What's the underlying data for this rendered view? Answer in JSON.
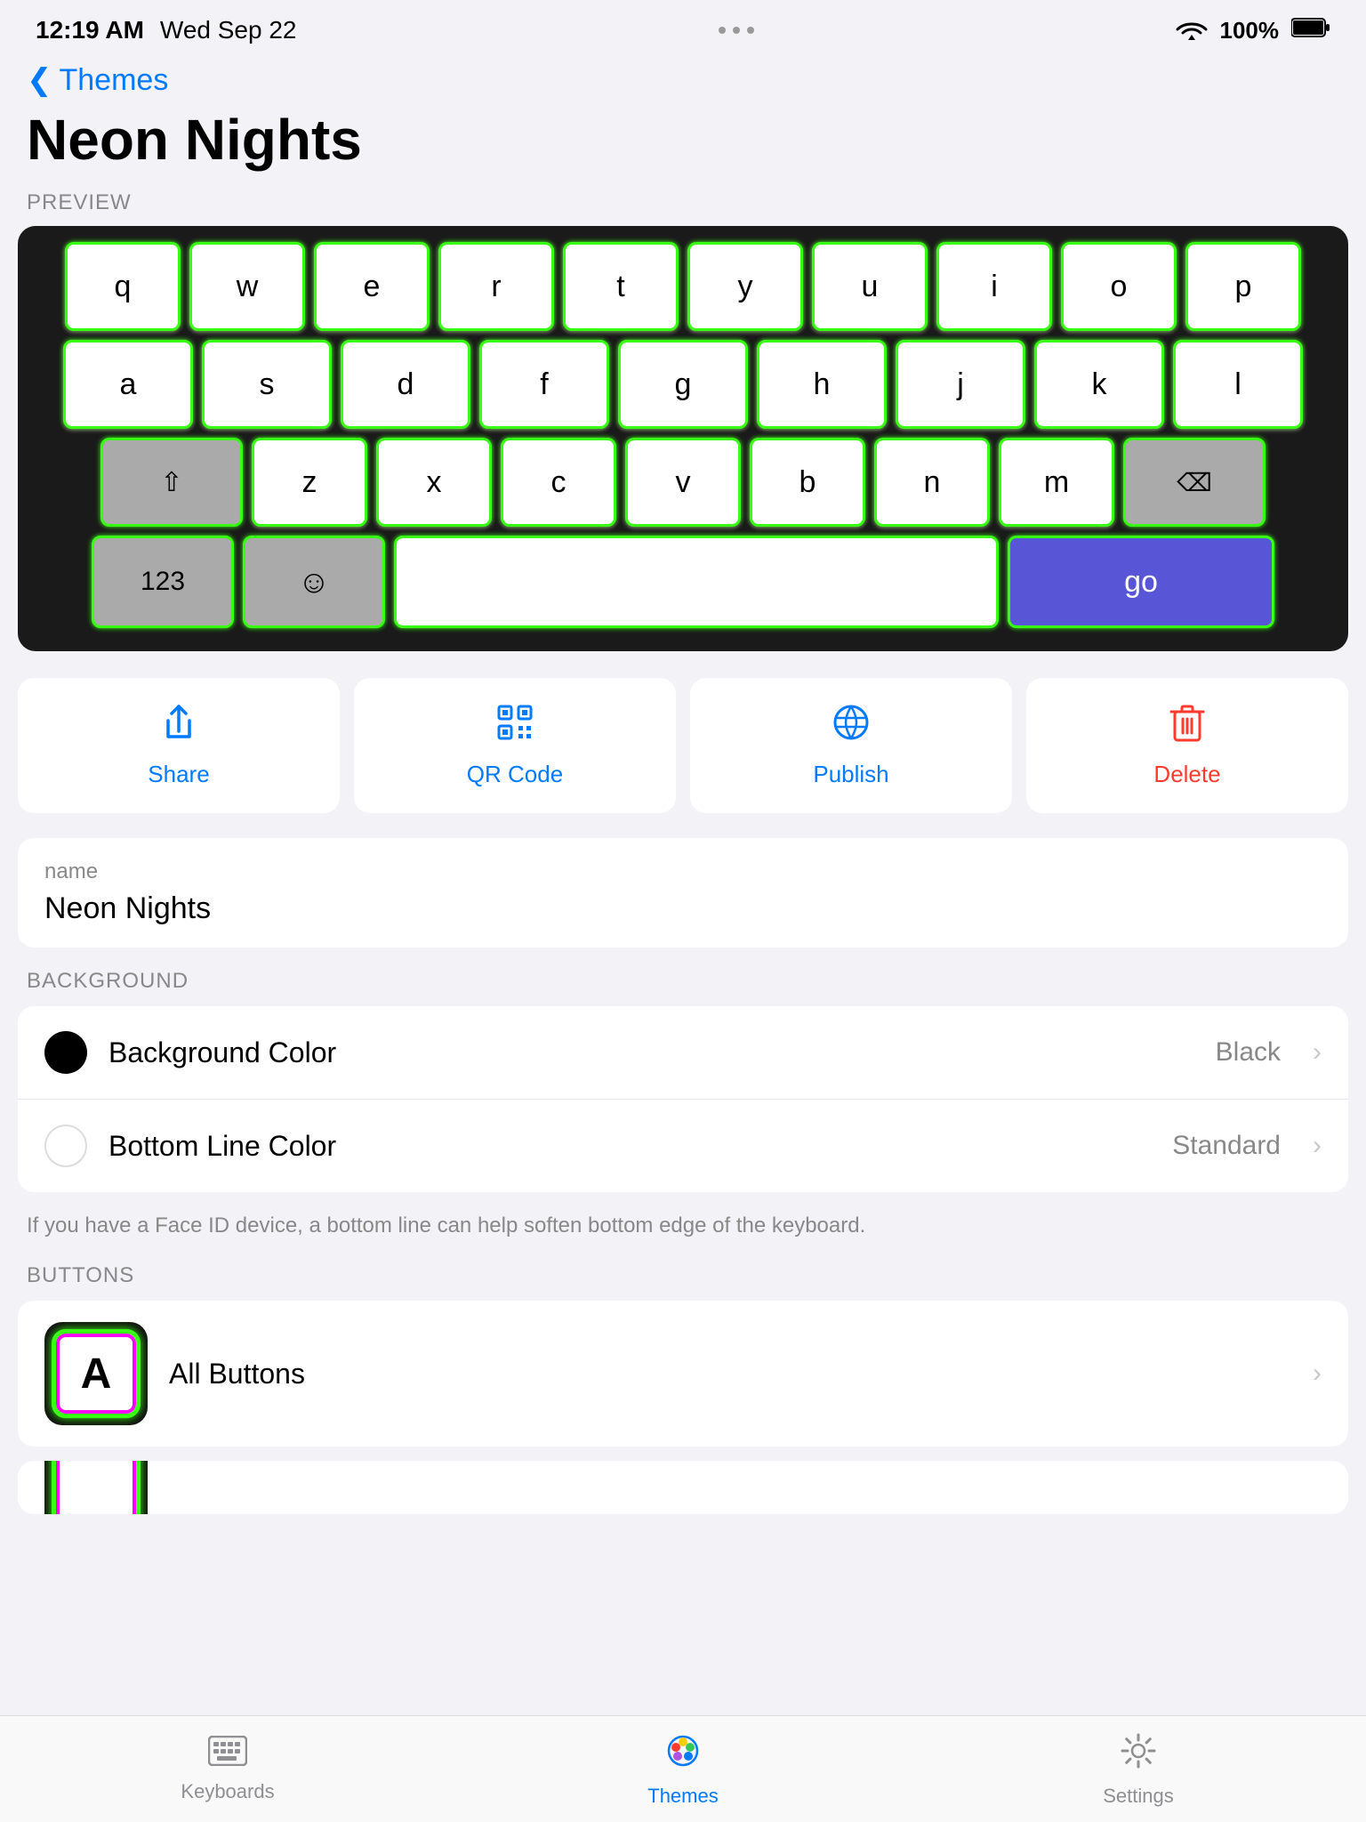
{
  "status": {
    "time": "12:19 AM",
    "date": "Wed Sep 22",
    "battery": "100%",
    "dots": [
      "•",
      "•",
      "•"
    ]
  },
  "nav": {
    "back_label": "Themes"
  },
  "page": {
    "title": "Neon Nights"
  },
  "preview": {
    "label": "PREVIEW"
  },
  "keyboard": {
    "rows": [
      [
        "q",
        "w",
        "e",
        "r",
        "t",
        "y",
        "u",
        "i",
        "o",
        "p"
      ],
      [
        "a",
        "s",
        "d",
        "f",
        "g",
        "h",
        "j",
        "k",
        "l"
      ],
      [
        "shift",
        "z",
        "x",
        "c",
        "v",
        "b",
        "n",
        "m",
        "delete"
      ],
      [
        "123",
        "emoji",
        "space",
        "go"
      ]
    ]
  },
  "actions": {
    "share": {
      "label": "Share",
      "icon": "⬆"
    },
    "qr_code": {
      "label": "QR Code",
      "icon": "⊞"
    },
    "publish": {
      "label": "Publish",
      "icon": "🌐"
    },
    "delete": {
      "label": "Delete",
      "icon": "🗑"
    }
  },
  "name_field": {
    "label": "name",
    "value": "Neon Nights"
  },
  "background": {
    "section_label": "BACKGROUND",
    "items": [
      {
        "label": "Background Color",
        "value": "Black",
        "icon_type": "black"
      },
      {
        "label": "Bottom Line Color",
        "value": "Standard",
        "icon_type": "white"
      }
    ],
    "hint": "If you have a Face ID device, a bottom line can help soften bottom edge of the keyboard."
  },
  "buttons": {
    "section_label": "BUTTONS",
    "items": [
      {
        "label": "All Buttons"
      }
    ]
  },
  "tab_bar": {
    "items": [
      {
        "label": "Keyboards",
        "icon": "⌨",
        "active": false
      },
      {
        "label": "Themes",
        "icon": "🎨",
        "active": true
      },
      {
        "label": "Settings",
        "icon": "⚙",
        "active": false
      }
    ]
  }
}
